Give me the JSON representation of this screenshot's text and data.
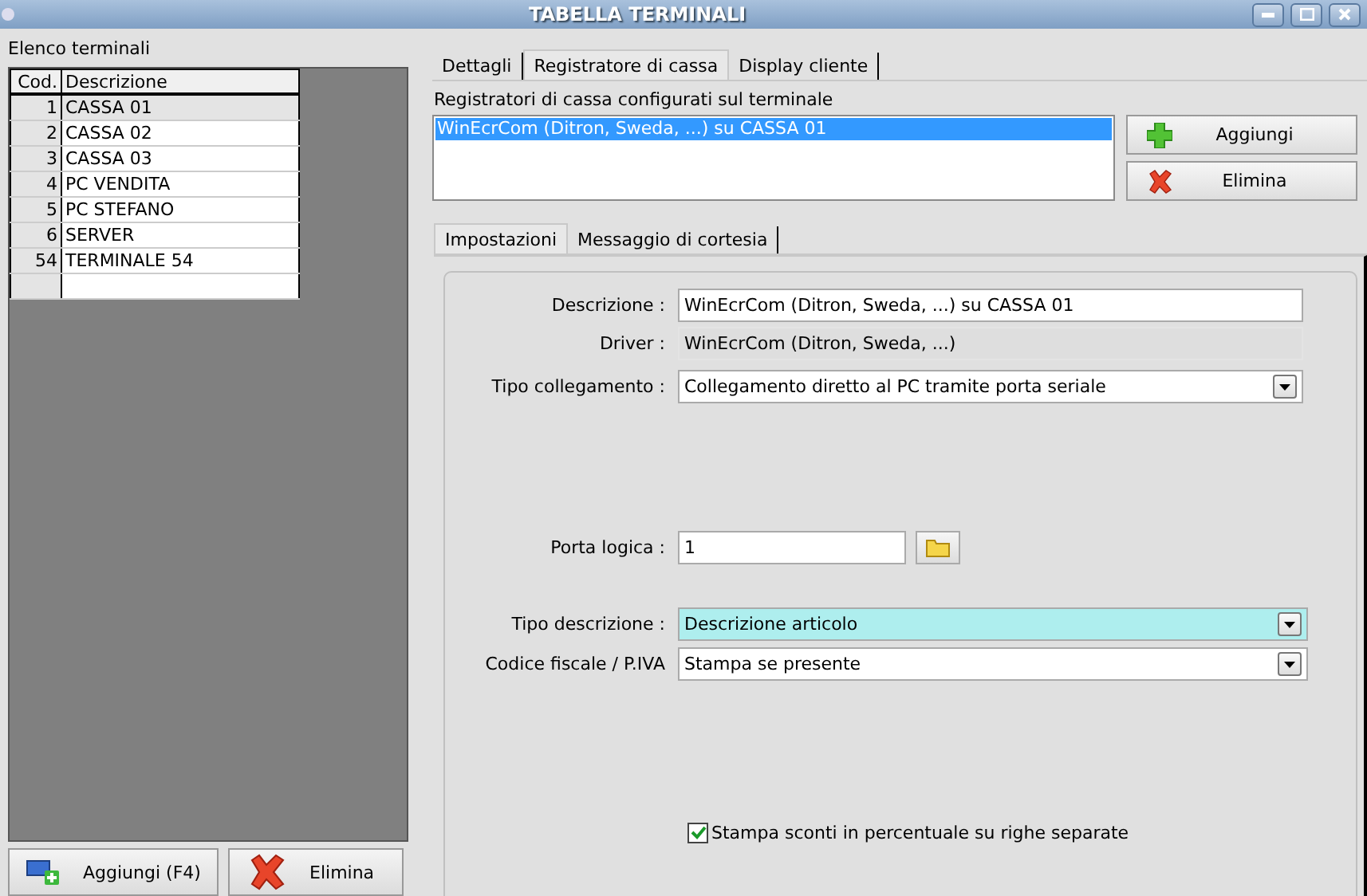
{
  "window": {
    "title": "TABELLA TERMINALI"
  },
  "terminals": {
    "legend": "Elenco terminali",
    "columns": [
      "Cod.",
      "Descrizione"
    ],
    "rows": [
      {
        "code": "1",
        "name": "CASSA 01",
        "selected": true
      },
      {
        "code": "2",
        "name": "CASSA 02",
        "selected": false
      },
      {
        "code": "3",
        "name": "CASSA 03",
        "selected": false
      },
      {
        "code": "4",
        "name": "PC VENDITA",
        "selected": false
      },
      {
        "code": "5",
        "name": "PC STEFANO",
        "selected": false
      },
      {
        "code": "6",
        "name": "SERVER",
        "selected": false
      },
      {
        "code": "54",
        "name": "TERMINALE 54",
        "selected": false
      }
    ],
    "buttons": [
      {
        "label": "Aggiungi (F4)",
        "kind": "add"
      },
      {
        "label": "Elimina",
        "kind": "delete"
      }
    ]
  },
  "tabs": [
    {
      "label": "Dettagli",
      "selected": false
    },
    {
      "label": "Registratore di cassa",
      "selected": true
    },
    {
      "label": "Display cliente",
      "selected": false
    }
  ],
  "registers": {
    "label": "Registratori di cassa configurati sul terminale",
    "items": [
      {
        "label": "WinEcrCom (Ditron, Sweda, ...) su CASSA 01",
        "selected": true
      }
    ],
    "buttons": [
      {
        "label": "Aggiungi",
        "kind": "add"
      },
      {
        "label": "Elimina",
        "kind": "delete"
      }
    ]
  },
  "subtabs": [
    {
      "label": "Impostazioni",
      "selected": true
    },
    {
      "label": "Messaggio di cortesia",
      "selected": false
    }
  ],
  "fields": [
    {
      "label": "Descrizione :",
      "kind": "text",
      "value": "WinEcrCom (Ditron, Sweda, ...) su CASSA 01"
    },
    {
      "label": "Driver :",
      "kind": "readonly",
      "value": "WinEcrCom (Ditron, Sweda, ...)"
    },
    {
      "label": "Tipo collegamento :",
      "kind": "select",
      "value": "Collegamento diretto al PC tramite porta seriale"
    },
    {
      "label": "Porta logica :",
      "kind": "browse",
      "value": "1"
    },
    {
      "label": "Tipo descrizione :",
      "kind": "select",
      "value": "Descrizione articolo",
      "highlighted": true
    },
    {
      "label": "Codice fiscale / P.IVA",
      "kind": "select",
      "value": "Stampa se presente"
    }
  ],
  "option": {
    "label": "Stampa sconti in percentuale su righe separate",
    "checked": true
  }
}
